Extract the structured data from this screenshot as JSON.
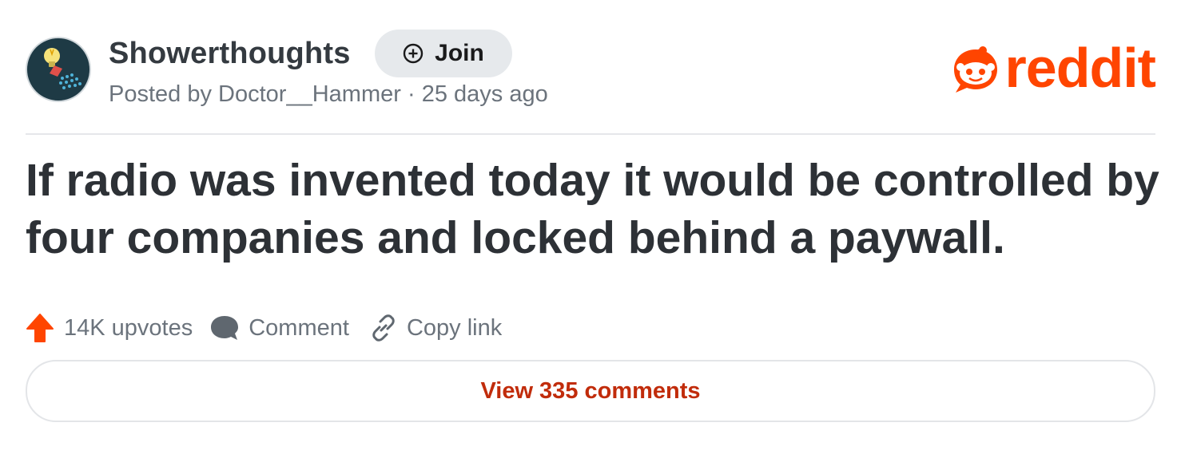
{
  "post": {
    "subreddit": "Showerthoughts",
    "join_label": "Join",
    "posted_by_prefix": "Posted by",
    "author": "Doctor__Hammer",
    "separator": "·",
    "age": "25 days ago",
    "title": "If radio was invented today it would be controlled by four companies and locked behind a paywall.",
    "avatar_icon": "lightbulb-shower-icon"
  },
  "brand": {
    "wordmark": "reddit",
    "logo_icon": "reddit-snoo-icon",
    "color": "#ff4500"
  },
  "actions": {
    "upvotes_label": "14K upvotes",
    "comment_label": "Comment",
    "copy_link_label": "Copy link",
    "upvote_icon": "upvote-arrow-icon",
    "comment_icon": "comment-bubble-icon",
    "link_icon": "link-icon"
  },
  "footer": {
    "view_comments_label": "View 335 comments",
    "accent_color": "#c12c0b"
  }
}
